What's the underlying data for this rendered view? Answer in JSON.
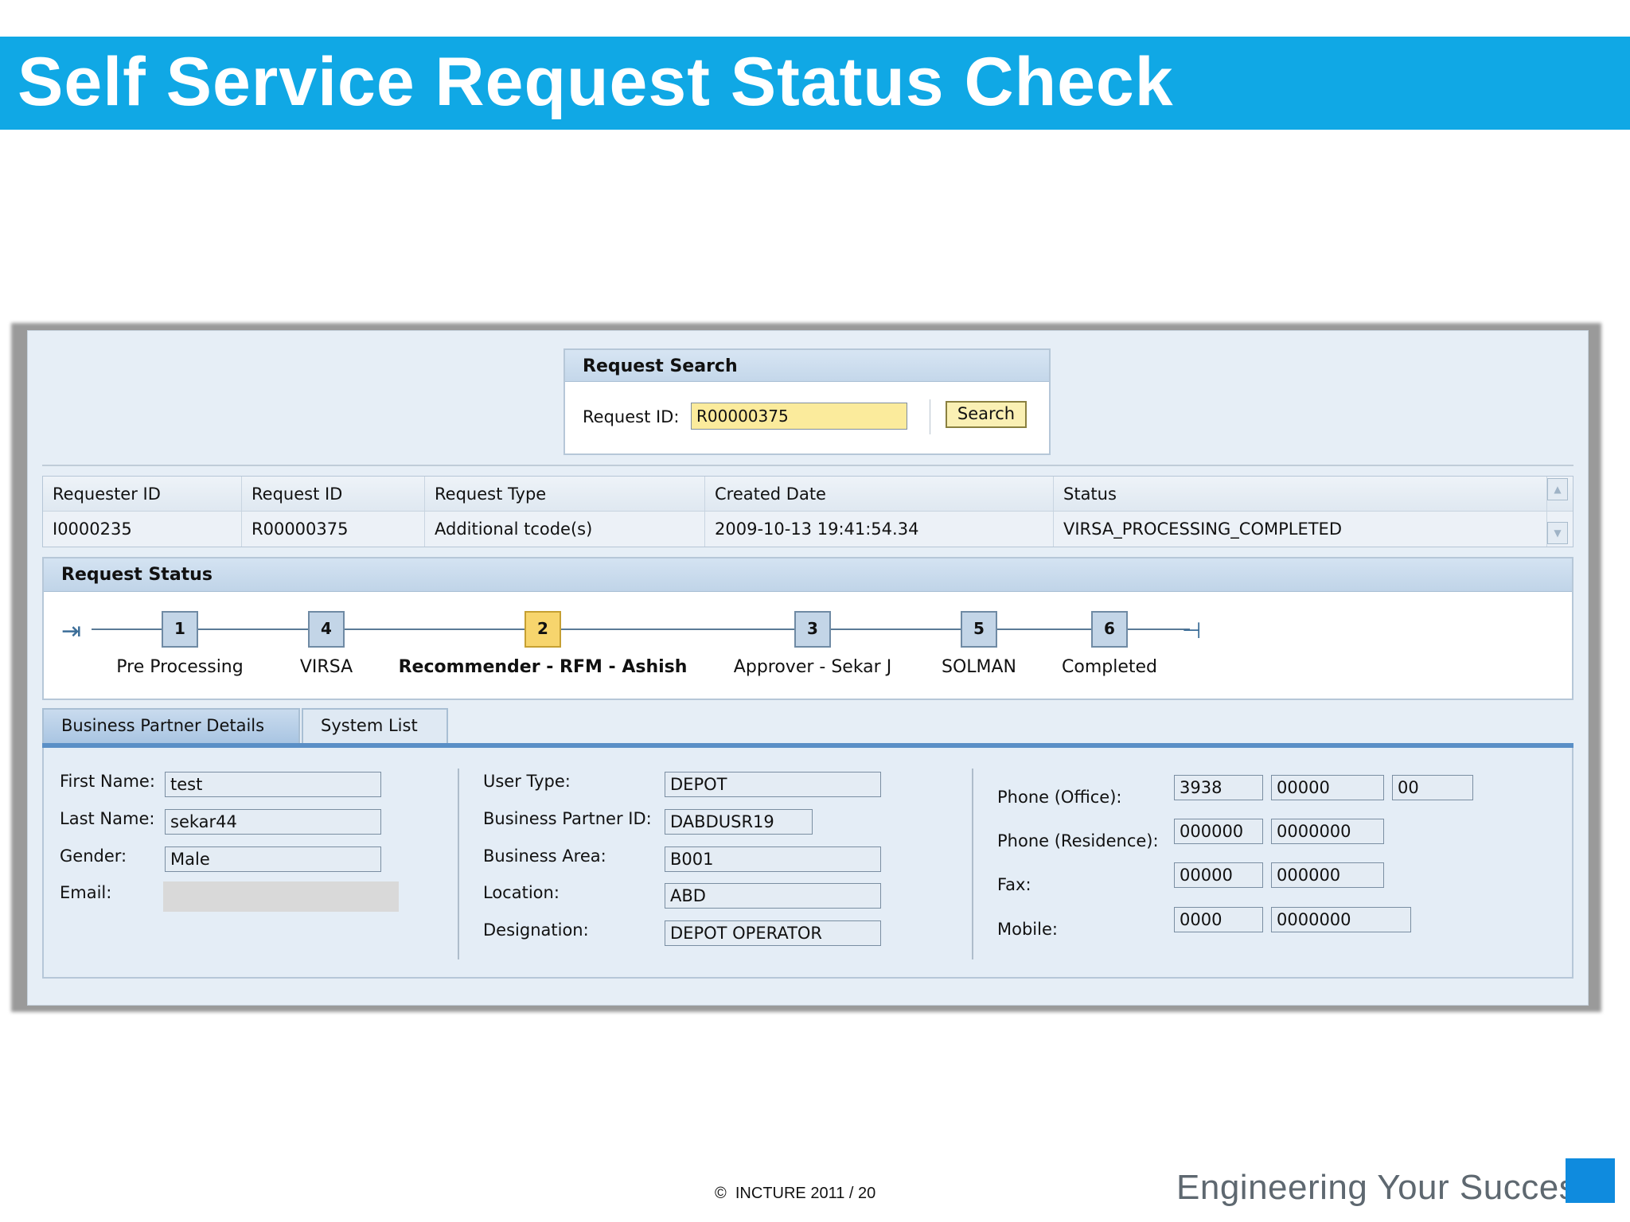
{
  "slide": {
    "title": "Self Service Request Status Check",
    "copyright_symbol": "©",
    "copyright": "INCTURE 2011 / 20",
    "tagline": "Engineering Your Success",
    "accent_color": "#10a8e5"
  },
  "search": {
    "panel_title": "Request Search",
    "request_id_label": "Request ID:",
    "request_id_value": "R00000375",
    "button_label": "Search"
  },
  "results": {
    "headers": [
      "Requester ID",
      "Request ID",
      "Request Type",
      "Created Date",
      "Status"
    ],
    "rows": [
      [
        "I0000235",
        "R00000375",
        "Additional tcode(s)",
        "2009-10-13 19:41:54.34",
        "VIRSA_PROCESSING_COMPLETED"
      ]
    ]
  },
  "request_status": {
    "panel_title": "Request Status",
    "steps": [
      {
        "number": "1",
        "label": "Pre Processing",
        "active": false
      },
      {
        "number": "4",
        "label": "VIRSA",
        "active": false
      },
      {
        "number": "2",
        "label": "Recommender - RFM - Ashish",
        "active": true
      },
      {
        "number": "3",
        "label": "Approver - Sekar J",
        "active": false
      },
      {
        "number": "5",
        "label": "SOLMAN",
        "active": false
      },
      {
        "number": "6",
        "label": "Completed",
        "active": false
      }
    ]
  },
  "tabs": {
    "business_partner": "Business Partner Details",
    "system_list": "System List",
    "selected": "Business Partner Details"
  },
  "details": {
    "first_name_label": "First Name:",
    "first_name": "test",
    "last_name_label": "Last Name:",
    "last_name": "sekar44",
    "gender_label": "Gender:",
    "gender": "Male",
    "email_label": "Email:",
    "email": "",
    "user_type_label": "User Type:",
    "user_type": "DEPOT",
    "bp_id_label": "Business Partner ID:",
    "bp_id": "DABDUSR19",
    "business_area_label": "Business Area:",
    "business_area": "B001",
    "location_label": "Location:",
    "location": "ABD",
    "designation_label": "Designation:",
    "designation": "DEPOT OPERATOR",
    "phone_office_label": "Phone (Office):",
    "phone_office": [
      "3938",
      "00000",
      "00"
    ],
    "phone_residence_label": "Phone (Residence):",
    "phone_residence": [
      "000000",
      "0000000"
    ],
    "fax_label": "Fax:",
    "fax": [
      "00000",
      "000000"
    ],
    "mobile_label": "Mobile:",
    "mobile": [
      "0000",
      "0000000"
    ]
  }
}
